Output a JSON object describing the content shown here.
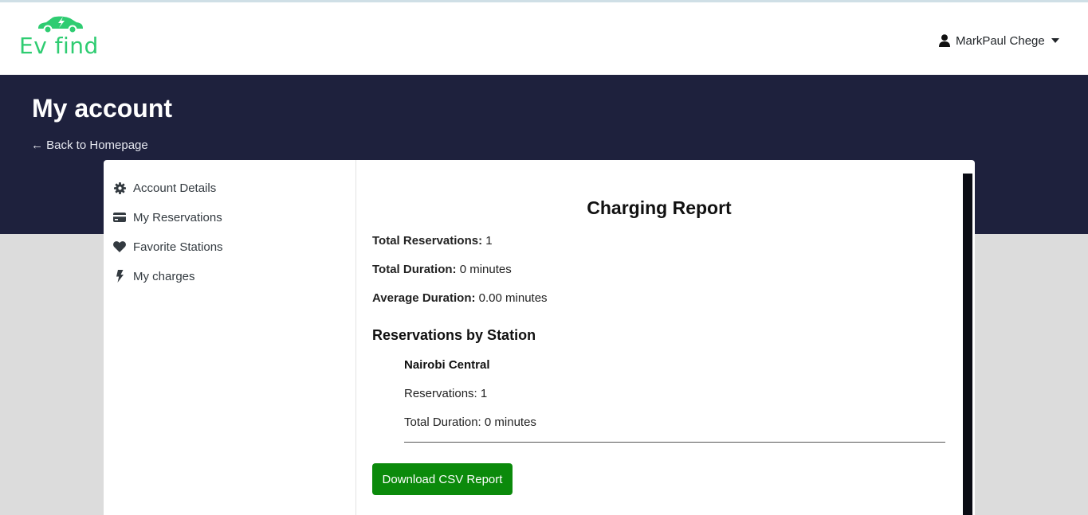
{
  "brand": {
    "name": "Ev find",
    "color": "#2ecc71"
  },
  "user_menu": {
    "name": "MarkPaul Chege",
    "icon": "user-icon"
  },
  "hero": {
    "title": "My account",
    "back_link": "← Back to Homepage",
    "background": "#1e213d"
  },
  "sidebar": {
    "items": [
      {
        "label": "Account Details",
        "icon": "gear-icon"
      },
      {
        "label": "My Reservations",
        "icon": "credit-card-icon"
      },
      {
        "label": "Favorite Stations",
        "icon": "heart-icon"
      },
      {
        "label": "My charges",
        "icon": "bolt-icon"
      }
    ]
  },
  "report": {
    "title": "Charging Report",
    "total_reservations_label": "Total Reservations:",
    "total_reservations_value": "1",
    "total_duration_label": "Total Duration:",
    "total_duration_value": "0 minutes",
    "average_duration_label": "Average Duration:",
    "average_duration_value": "0.00 minutes",
    "section_title": "Reservations by Station",
    "stations": [
      {
        "name": "Nairobi Central",
        "reservations": "Reservations: 1",
        "duration": "Total Duration: 0 minutes"
      }
    ],
    "download_button": "Download CSV Report",
    "button_color": "#0b8a0b"
  }
}
